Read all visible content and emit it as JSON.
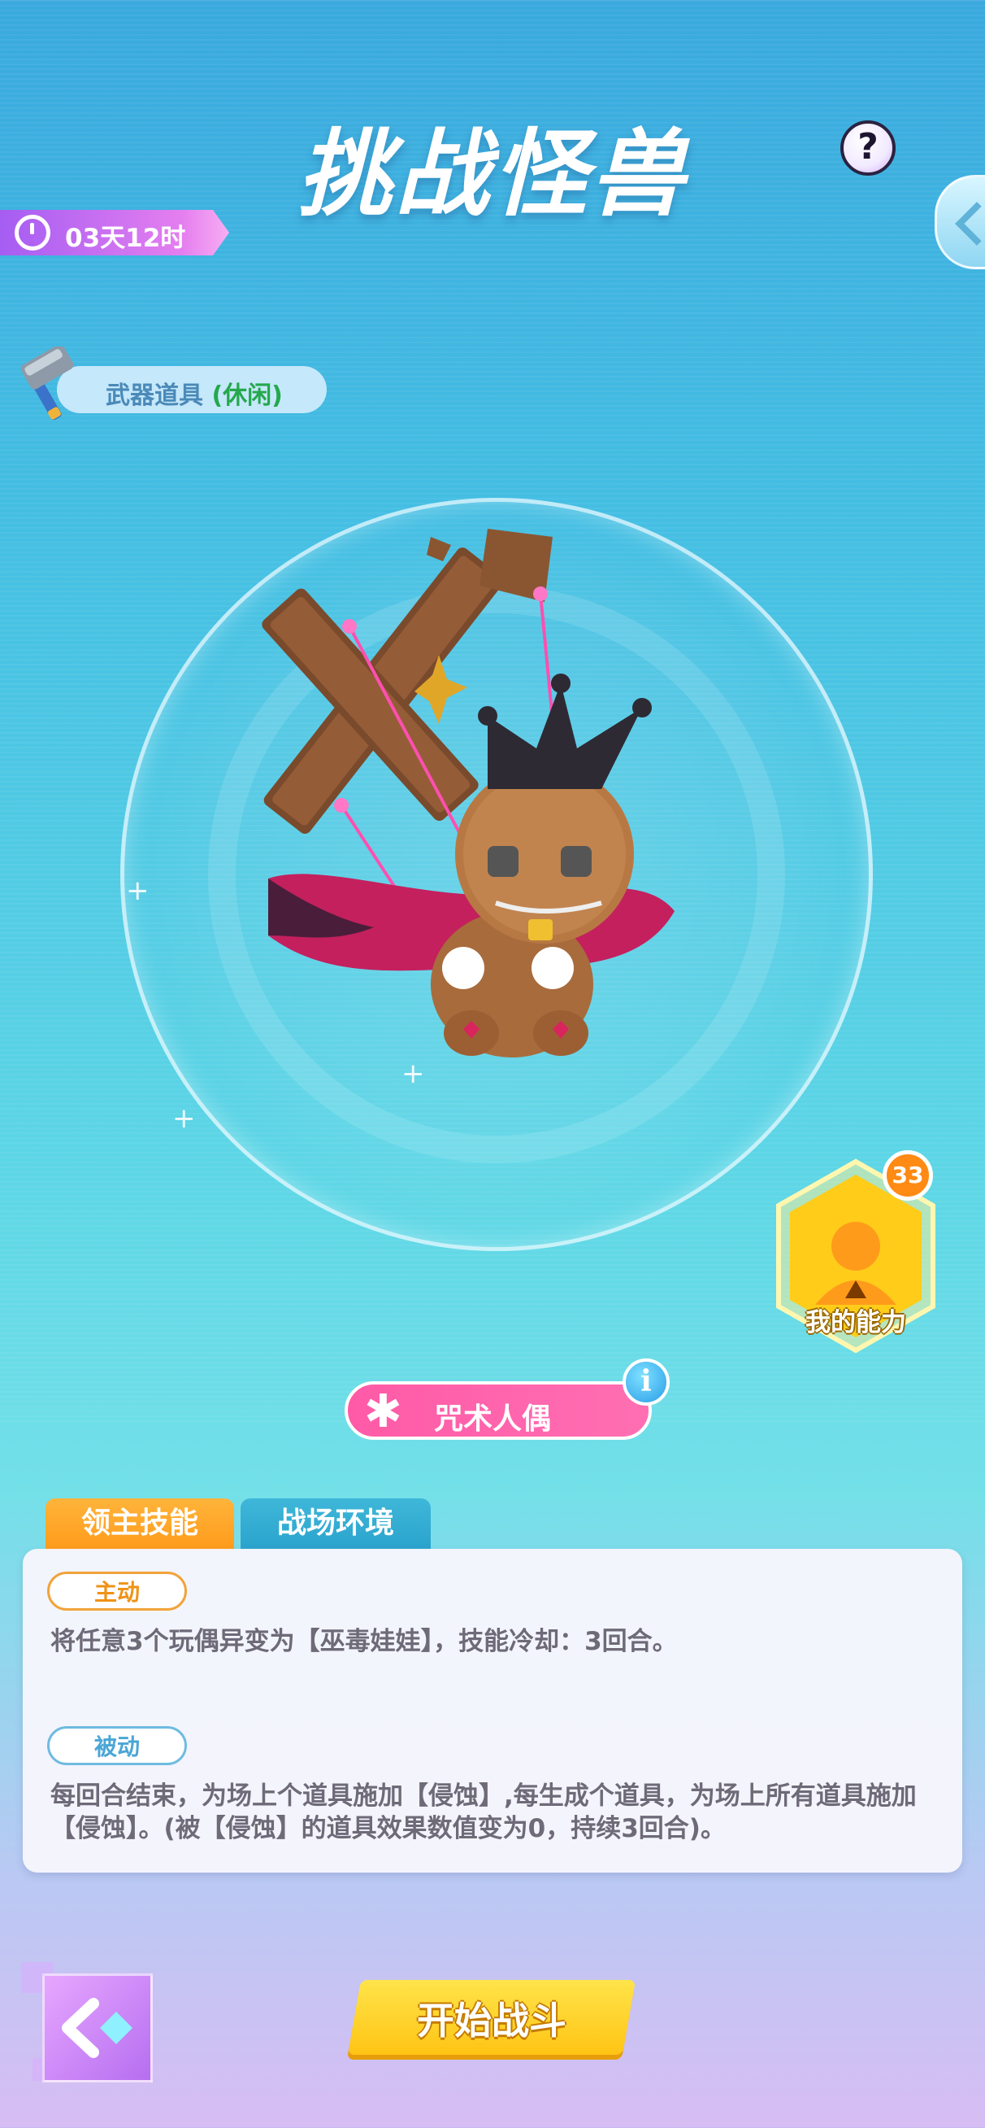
{
  "header": {
    "title": "挑战怪兽",
    "help_symbol": "?"
  },
  "timer": {
    "text": "03天12时"
  },
  "weapon": {
    "label": "武器道具",
    "tag": "(休闲)"
  },
  "ability": {
    "label": "我的能力",
    "count": "33"
  },
  "boss": {
    "name": "咒术人偶",
    "icon": "asterisk-icon",
    "info_symbol": "i"
  },
  "tabs": [
    {
      "label": "领主技能",
      "active": true
    },
    {
      "label": "战场环境",
      "active": false
    }
  ],
  "skills": {
    "active_label": "主动",
    "active_desc": "将任意3个玩偶异变为【巫毒娃娃】，技能冷却：3回合。",
    "passive_label": "被动",
    "passive_desc": "每回合结束，为场上个道具施加【侵蚀】,每生成个道具，为场上所有道具施加【侵蚀】。(被【侵蚀】的道具效果数值变为0，持续3回合)。"
  },
  "actions": {
    "start": "开始战斗"
  },
  "colors": {
    "accent_orange": "#ff9b1a",
    "accent_pink": "#ff5aa7",
    "accent_blue": "#2aa3cd",
    "button_yellow": "#ffc414"
  }
}
